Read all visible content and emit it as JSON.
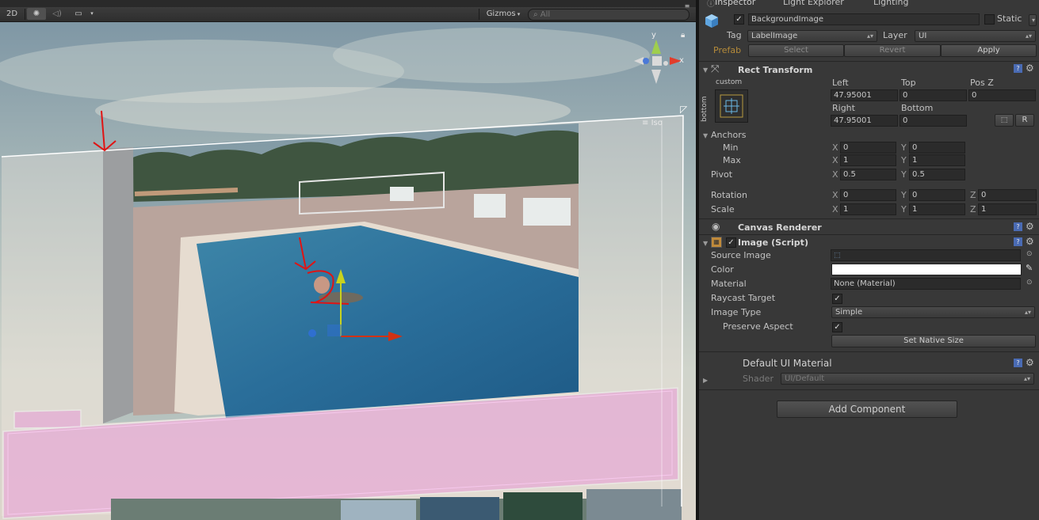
{
  "toolbar": {
    "mode_2d": "2D",
    "gizmos_label": "Gizmos",
    "search_placeholder": "All",
    "search_prefix": "Q"
  },
  "scene": {
    "orientation_label": "Iso",
    "axis_y": "y",
    "axis_x": "x"
  },
  "inspector": {
    "tabs": [
      "Inspector",
      "Light Explorer",
      "Lighting"
    ],
    "object": {
      "name": "BackgroundImage",
      "active": true,
      "static_label": "Static",
      "tag_label": "Tag",
      "tag_value": "LabelImage",
      "layer_label": "Layer",
      "layer_value": "UI",
      "prefab_label": "Prefab",
      "prefab_select": "Select",
      "prefab_revert": "Revert",
      "prefab_apply": "Apply"
    },
    "rect_transform": {
      "title": "Rect Transform",
      "anchor_preset_top": "custom",
      "anchor_preset_side": "bottom",
      "left_label": "Left",
      "left_value": "47.95001",
      "top_label": "Top",
      "top_value": "0",
      "posz_label": "Pos Z",
      "posz_value": "0",
      "right_label": "Right",
      "right_value": "47.95001",
      "bottom_label": "Bottom",
      "bottom_value": "0",
      "r_button": "R",
      "anchors_label": "Anchors",
      "min_label": "Min",
      "min_x": "0",
      "min_y": "0",
      "max_label": "Max",
      "max_x": "1",
      "max_y": "1",
      "pivot_label": "Pivot",
      "pivot_x": "0.5",
      "pivot_y": "0.5",
      "rotation_label": "Rotation",
      "rotation_x": "0",
      "rotation_y": "0",
      "rotation_z": "0",
      "scale_label": "Scale",
      "scale_x": "1",
      "scale_y": "1",
      "scale_z": "1",
      "x": "X",
      "y": "Y",
      "z": "Z"
    },
    "canvas_renderer": {
      "title": "Canvas Renderer"
    },
    "image_script": {
      "title": "Image (Script)",
      "source_image_label": "Source Image",
      "color_label": "Color",
      "color_value": "#ffffff",
      "material_label": "Material",
      "material_value": "None (Material)",
      "raycast_label": "Raycast Target",
      "image_type_label": "Image Type",
      "image_type_value": "Simple",
      "preserve_label": "Preserve Aspect",
      "native_size_button": "Set Native Size"
    },
    "material": {
      "title": "Default UI Material",
      "shader_label": "Shader",
      "shader_value": "UI/Default"
    },
    "add_component": "Add Component"
  },
  "colors": {
    "annotation_red": "#e01414",
    "gizmo_y": "#c8d21e",
    "gizmo_x": "#d23214",
    "prefab_orange": "#b58b3a",
    "overlay_pink": "#e89bd6"
  }
}
